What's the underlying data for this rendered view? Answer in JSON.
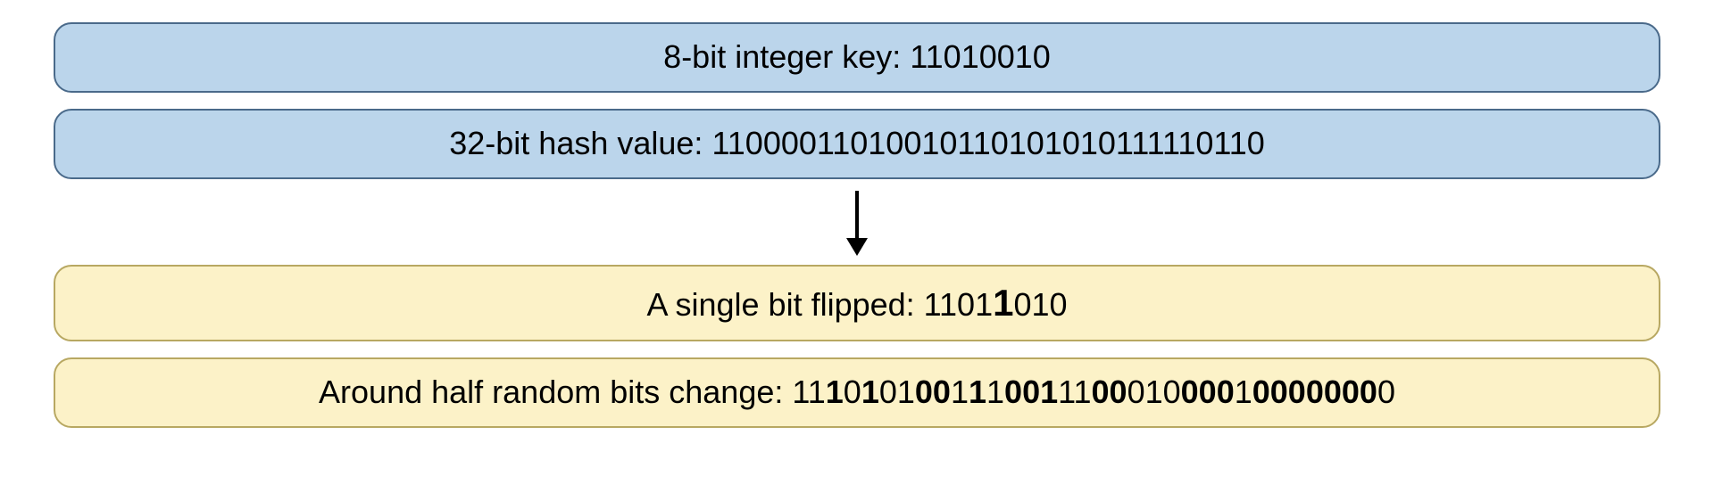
{
  "box1": {
    "label": "8-bit integer key: ",
    "value": "11010010"
  },
  "box2": {
    "label": "32-bit hash value: ",
    "value": "11000011010010110101010111110110"
  },
  "box3": {
    "label": "A single bit flipped: ",
    "prefix": "1101",
    "flipped": "1",
    "suffix": "010"
  },
  "box4": {
    "label": "Around half random bits change: ",
    "segments": [
      {
        "text": "11",
        "bold": false
      },
      {
        "text": "1",
        "bold": true
      },
      {
        "text": "0",
        "bold": false
      },
      {
        "text": "1",
        "bold": true
      },
      {
        "text": "01",
        "bold": false
      },
      {
        "text": "0",
        "bold": true
      },
      {
        "text": "0",
        "bold": true
      },
      {
        "text": "1",
        "bold": false
      },
      {
        "text": "1",
        "bold": true
      },
      {
        "text": "1",
        "bold": false
      },
      {
        "text": "001",
        "bold": true
      },
      {
        "text": "11",
        "bold": false
      },
      {
        "text": "0",
        "bold": true
      },
      {
        "text": "0",
        "bold": true
      },
      {
        "text": "010",
        "bold": false
      },
      {
        "text": "0",
        "bold": true
      },
      {
        "text": "0",
        "bold": true
      },
      {
        "text": "0",
        "bold": true
      },
      {
        "text": "1",
        "bold": false
      },
      {
        "text": "0000",
        "bold": true
      },
      {
        "text": "000",
        "bold": true
      },
      {
        "text": "0",
        "bold": false
      }
    ]
  }
}
